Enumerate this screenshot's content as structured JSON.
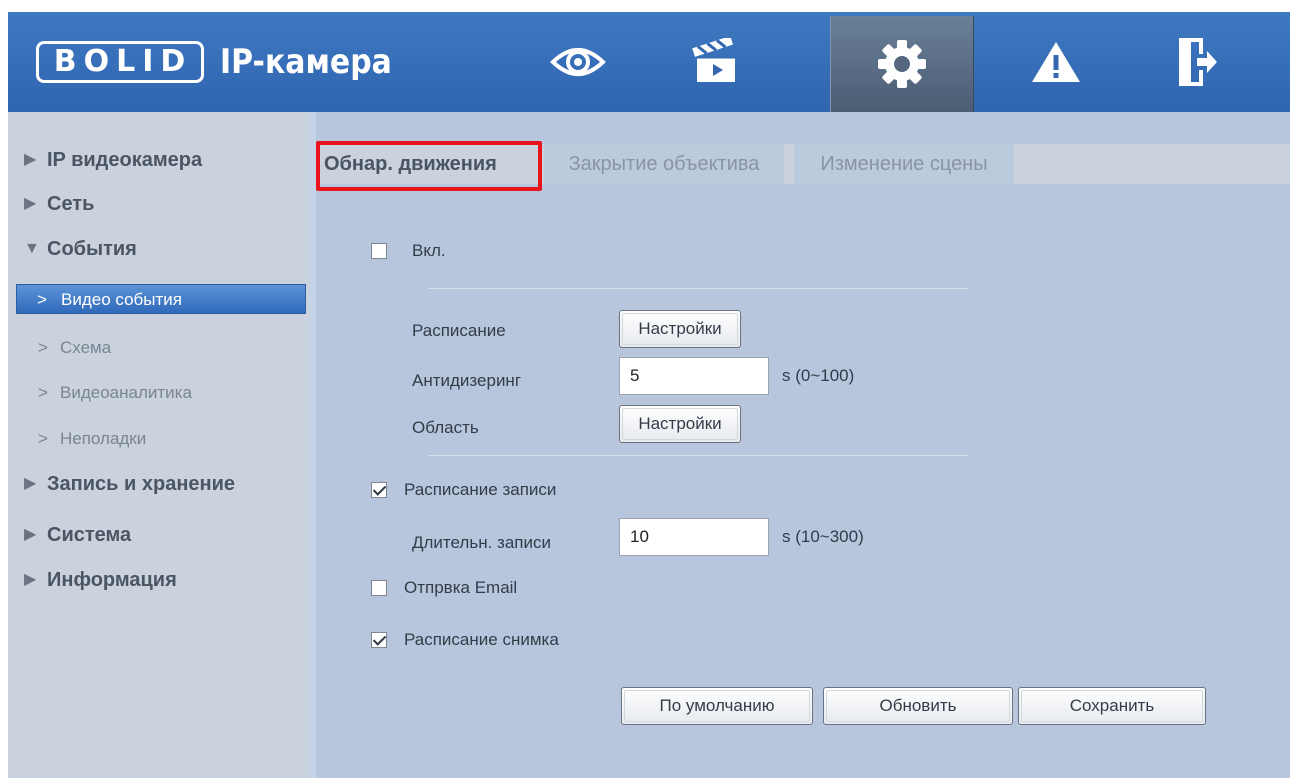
{
  "header": {
    "logo_text": "BOLID",
    "title": "IP-камера",
    "nav": [
      {
        "icon": "eye-icon"
      },
      {
        "icon": "clapperboard-icon"
      },
      {
        "icon": "gear-icon",
        "active": true
      },
      {
        "icon": "warning-icon"
      },
      {
        "icon": "logout-icon"
      }
    ]
  },
  "sidebar": {
    "groups": {
      "camera": {
        "arrow": "▶",
        "label": "IP видеокамера"
      },
      "network": {
        "arrow": "▶",
        "label": "Сеть"
      },
      "events": {
        "arrow": "▼",
        "label": "События"
      },
      "storage": {
        "arrow": "▶",
        "label": "Запись и хранение"
      },
      "system": {
        "arrow": "▶",
        "label": "Система"
      },
      "info": {
        "arrow": "▶",
        "label": "Информация"
      }
    },
    "event_items": {
      "video_events": {
        "chev": ">",
        "label": "Видео события"
      },
      "scheme": {
        "chev": ">",
        "label": "Схема"
      },
      "analytics": {
        "chev": ">",
        "label": "Видеоаналитика"
      },
      "faults": {
        "chev": ">",
        "label": "Неполадки"
      }
    }
  },
  "tabs": {
    "motion": "Обнар. движения",
    "lens": "Закрытие объектива",
    "scene": "Изменение сцены"
  },
  "form": {
    "enable": {
      "label": "Вкл.",
      "checked": false
    },
    "schedule": {
      "label": "Расписание",
      "button": "Настройки"
    },
    "antidither": {
      "label": "Антидизеринг",
      "value": "5",
      "range": "s (0~100)"
    },
    "area": {
      "label": "Область",
      "button": "Настройки"
    },
    "record_schedule": {
      "label": "Расписание записи",
      "checked": true
    },
    "record_duration": {
      "label": "Длительн. записи",
      "value": "10",
      "range": "s (10~300)"
    },
    "send_email": {
      "label": "Отпрвка Email",
      "checked": false
    },
    "snapshot_schedule": {
      "label": "Расписание снимка",
      "checked": true
    }
  },
  "actions": {
    "default": "По умолчанию",
    "refresh": "Обновить",
    "save": "Сохранить"
  },
  "colors": {
    "header": "#3466b2",
    "active_tab_highlight": "#e8141c",
    "sidebar_active": "#3f7bc9"
  }
}
